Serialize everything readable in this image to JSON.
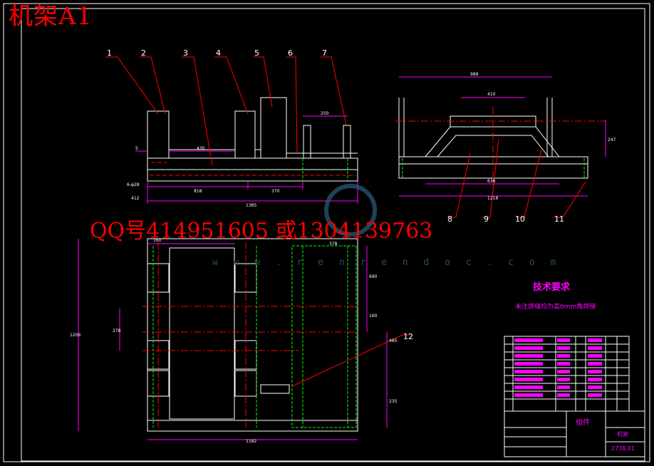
{
  "header": {
    "frame_title": "机架A1"
  },
  "watermark": {
    "contact": "QQ号414951605 或1304139763",
    "site": "w w w . r e n r e n d o c . c o m"
  },
  "callouts": [
    "1",
    "2",
    "3",
    "4",
    "5",
    "6",
    "7",
    "8",
    "9",
    "10",
    "11",
    "12"
  ],
  "dimensions": {
    "front_view": [
      "5",
      "430",
      "6-φ28",
      "412",
      "818",
      "370",
      "1385",
      "250"
    ],
    "side_view": [
      "989",
      "410",
      "247",
      "636",
      "1218"
    ],
    "plan_view": [
      "160",
      "1206",
      "278",
      "378",
      "690",
      "485",
      "235",
      "160",
      "1182"
    ]
  },
  "technical_requirements": {
    "title": "技术要求",
    "text": "未注焊缝均为高6mm角焊缝"
  },
  "title_block": {
    "assembly_label": "组件",
    "part_name": "机架",
    "drawing_number": "2738.01"
  },
  "colors": {
    "background": "#000000",
    "outline": "#ffffff",
    "leader": "#ff0000",
    "hidden": "#ff0000",
    "green": "#00ff00",
    "dimension": "#ff00ff",
    "center": "#ff0000"
  }
}
